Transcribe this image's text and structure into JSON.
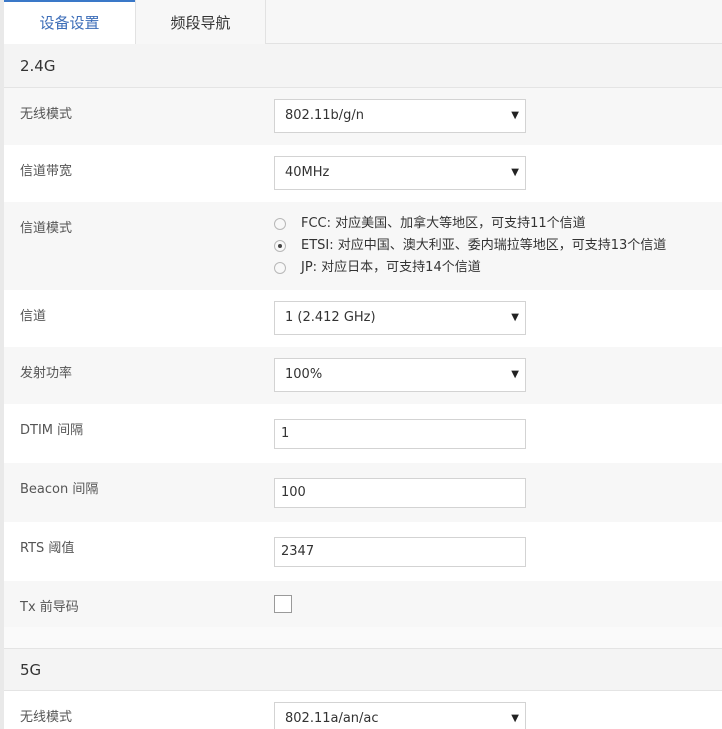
{
  "tabs": [
    {
      "label": "设备设置",
      "active": true
    },
    {
      "label": "频段导航",
      "active": false
    }
  ],
  "band_24g": {
    "title": "2.4G",
    "wireless_mode": {
      "label": "无线模式",
      "value": "802.11b/g/n"
    },
    "channel_width": {
      "label": "信道带宽",
      "value": "40MHz"
    },
    "channel_mode": {
      "label": "信道模式",
      "options": [
        {
          "text": "FCC: 对应美国、加拿大等地区，可支持11个信道",
          "checked": false
        },
        {
          "text": "ETSI: 对应中国、澳大利亚、委内瑞拉等地区，可支持13个信道",
          "checked": true
        },
        {
          "text": "JP: 对应日本，可支持14个信道",
          "checked": false
        }
      ]
    },
    "channel": {
      "label": "信道",
      "value": "1 (2.412 GHz)"
    },
    "tx_power": {
      "label": "发射功率",
      "value": "100%"
    },
    "dtim": {
      "label": "DTIM 间隔",
      "value": "1"
    },
    "beacon": {
      "label": "Beacon 间隔",
      "value": "100"
    },
    "rts": {
      "label": "RTS 阈值",
      "value": "2347"
    },
    "tx_preamble": {
      "label": "Tx 前导码",
      "checked": false
    }
  },
  "band_5g": {
    "title": "5G",
    "wireless_mode": {
      "label": "无线模式",
      "value": "802.11a/an/ac"
    }
  },
  "icons": {
    "caret": "▼"
  }
}
